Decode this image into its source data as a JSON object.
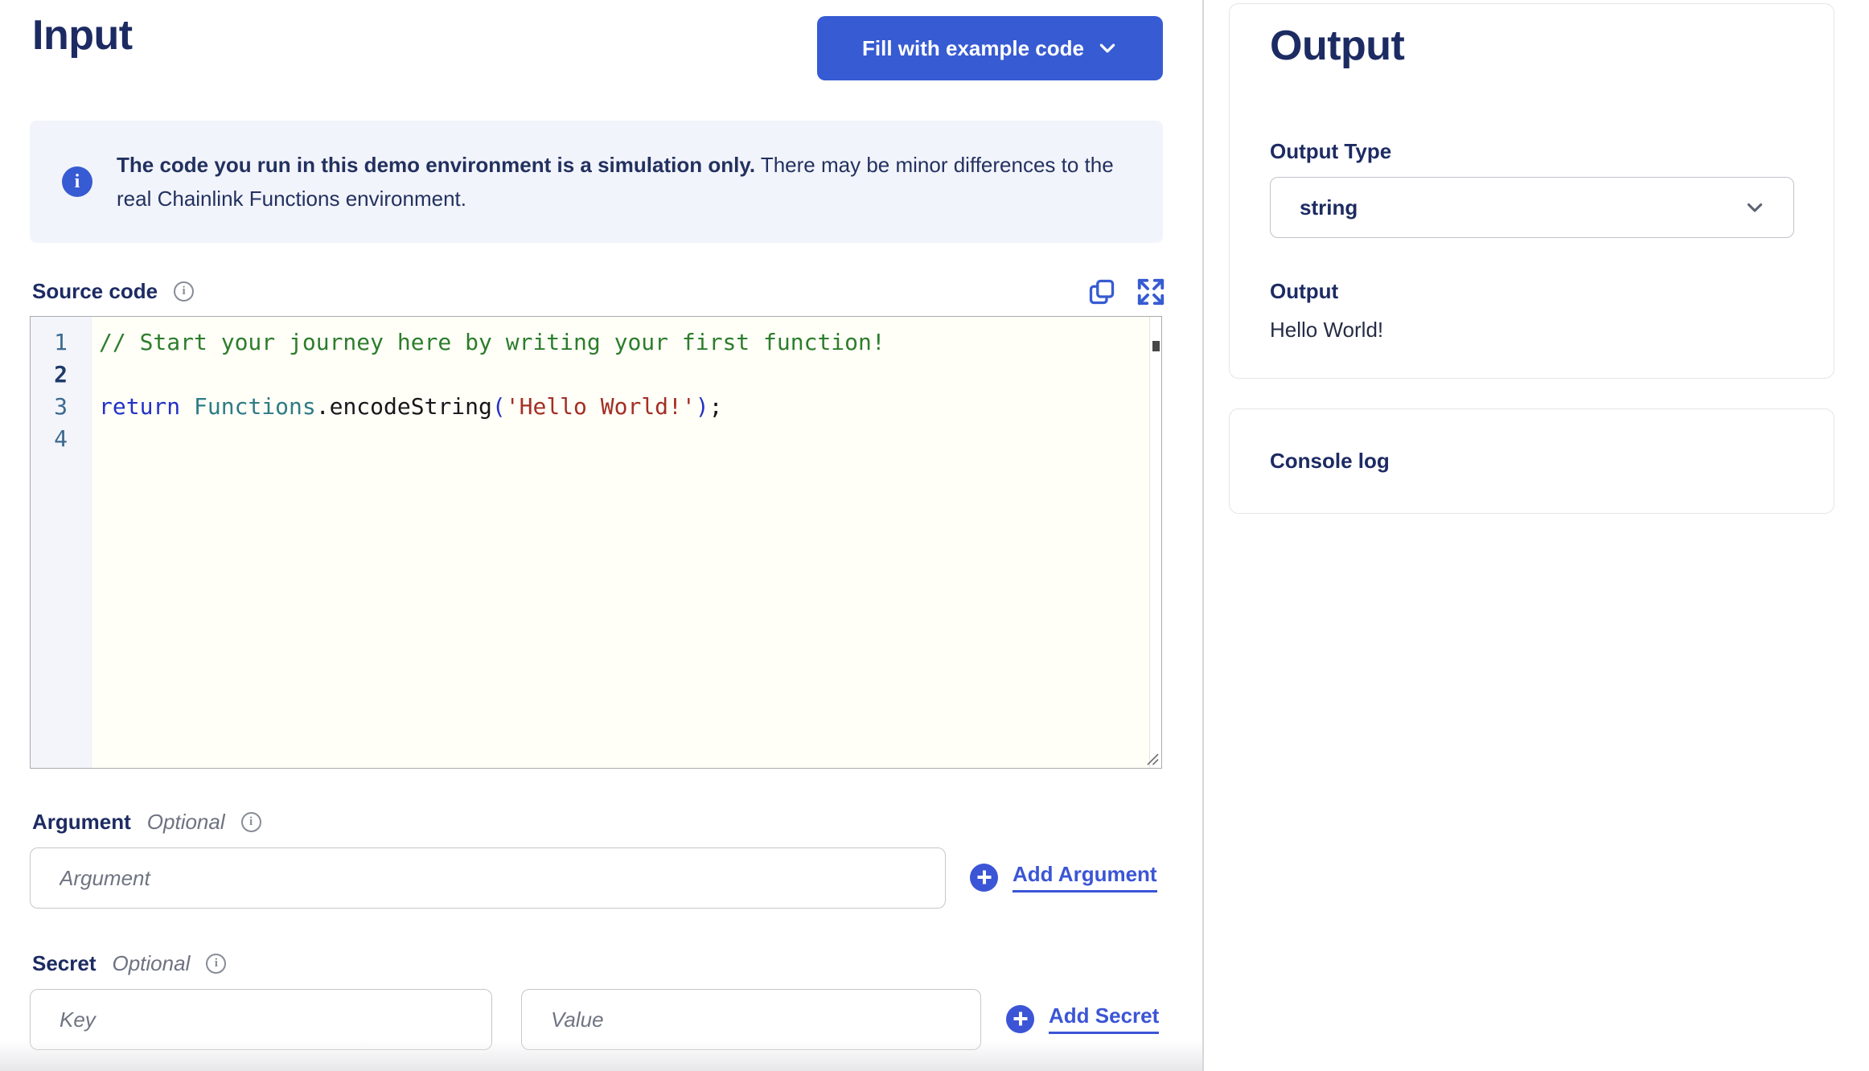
{
  "colors": {
    "accent": "#375bd2",
    "link": "#3b55d6",
    "heading": "#1d2b63",
    "navy": "#22315f",
    "text-dark": "#252c44",
    "muted": "#6d7280",
    "banner-bg": "#f2f4fb",
    "editor-bg": "#fffef7",
    "code-comment": "#2c7d2c",
    "code-keyword": "#2231c8",
    "code-type": "#2e7b85",
    "code-string": "#a32f26",
    "line-number": "#3d6a8f"
  },
  "input_panel": {
    "title": "Input",
    "fill_button_label": "Fill with example code",
    "banner_bold": "The code you run in this demo environment is a simulation only.",
    "banner_text": "There may be minor differences to the real Chainlink Functions environment.",
    "source_code_label": "Source code",
    "editor": {
      "lines": [
        {
          "num": "1",
          "active": false,
          "tokens": [
            {
              "text": "// Start your journey here by writing your first function!",
              "type": "comment"
            }
          ]
        },
        {
          "num": "2",
          "active": true,
          "tokens": []
        },
        {
          "num": "3",
          "active": false,
          "tokens": [
            {
              "text": "return",
              "type": "keyword"
            },
            {
              "text": " ",
              "type": "plain"
            },
            {
              "text": "Functions",
              "type": "type"
            },
            {
              "text": ".encodeString",
              "type": "plain"
            },
            {
              "text": "(",
              "type": "paren"
            },
            {
              "text": "'Hello World!'",
              "type": "string"
            },
            {
              "text": ")",
              "type": "paren"
            },
            {
              "text": ";",
              "type": "plain"
            }
          ]
        },
        {
          "num": "4",
          "active": false,
          "tokens": []
        }
      ]
    },
    "argument_label": "Argument",
    "argument_optional": "Optional",
    "argument_placeholder": "Argument",
    "add_argument_label": "Add Argument",
    "secret_label": "Secret",
    "secret_optional": "Optional",
    "key_placeholder": "Key",
    "value_placeholder": "Value",
    "add_secret_label": "Add Secret"
  },
  "output_panel": {
    "title": "Output",
    "output_type_label": "Output Type",
    "output_type_value": "string",
    "output_label": "Output",
    "output_value": "Hello World!",
    "console_log_label": "Console log"
  }
}
